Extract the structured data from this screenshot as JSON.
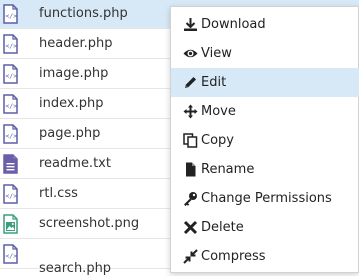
{
  "files": [
    {
      "name": "functions.php",
      "type": "code",
      "selected": true
    },
    {
      "name": "header.php",
      "type": "code",
      "selected": false
    },
    {
      "name": "image.php",
      "type": "code",
      "selected": false
    },
    {
      "name": "index.php",
      "type": "code",
      "selected": false
    },
    {
      "name": "page.php",
      "type": "code",
      "selected": false
    },
    {
      "name": "readme.txt",
      "type": "text",
      "selected": false
    },
    {
      "name": "rtl.css",
      "type": "code",
      "selected": false
    },
    {
      "name": "screenshot.png",
      "type": "image",
      "selected": false
    },
    {
      "name": "search.php",
      "type": "code",
      "selected": false
    }
  ],
  "context_menu": {
    "items": [
      {
        "label": "Download",
        "icon": "download-icon"
      },
      {
        "label": "View",
        "icon": "eye-icon"
      },
      {
        "label": "Edit",
        "icon": "pencil-icon",
        "active": true
      },
      {
        "label": "Move",
        "icon": "move-icon"
      },
      {
        "label": "Copy",
        "icon": "copy-icon"
      },
      {
        "label": "Rename",
        "icon": "file-icon"
      },
      {
        "label": "Change Permissions",
        "icon": "key-icon"
      },
      {
        "label": "Delete",
        "icon": "x-icon"
      },
      {
        "label": "Compress",
        "icon": "compress-icon"
      }
    ]
  },
  "colors": {
    "selected_row": "#d7e9f7",
    "code_icon": "#5b5ea6",
    "text_icon": "#6b5fa8",
    "image_icon": "#3a9f7b"
  }
}
